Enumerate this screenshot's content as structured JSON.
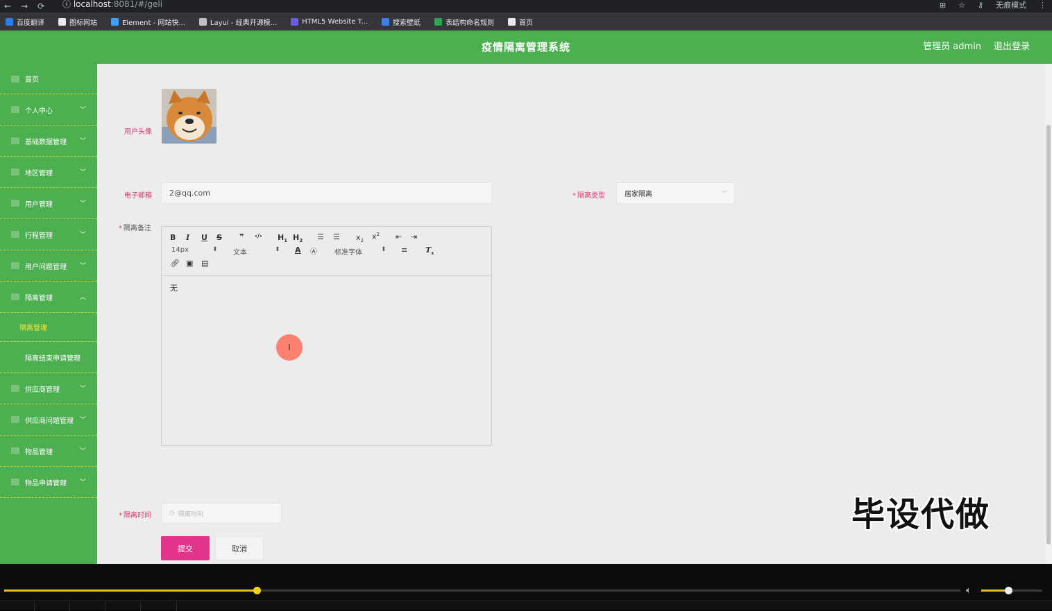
{
  "browser": {
    "url_host": "localhost",
    "url_rest": ":8081/#/geli",
    "mode_label": "无痕模式"
  },
  "bookmarks": [
    {
      "label": "百度翻译",
      "color": "#2b7de9"
    },
    {
      "label": "图标网站",
      "color": "#e8eaed"
    },
    {
      "label": "Element - 网站快...",
      "color": "#409eff"
    },
    {
      "label": "Layui - 经典开源模...",
      "color": "#c0c0c0"
    },
    {
      "label": "HTML5 Website T...",
      "color": "#6c5ce7"
    },
    {
      "label": "搜索壁纸",
      "color": "#3f7ee8"
    },
    {
      "label": "表结构命名规则",
      "color": "#2ea44f"
    },
    {
      "label": "首页",
      "color": "#e8eaed"
    }
  ],
  "header": {
    "title": "疫情隔离管理系统",
    "user": "管理员 admin",
    "logout": "退出登录"
  },
  "sidebar": {
    "items": [
      {
        "label": "首页"
      },
      {
        "label": "个人中心"
      },
      {
        "label": "基础数据管理"
      },
      {
        "label": "地区管理"
      },
      {
        "label": "用户管理"
      },
      {
        "label": "行程管理"
      },
      {
        "label": "用户问题管理"
      },
      {
        "label": "隔离管理"
      }
    ],
    "sub_items": [
      "隔离管理",
      "隔离结束申请管理"
    ],
    "items_after": [
      {
        "label": "供应商管理"
      },
      {
        "label": "供应商问题管理"
      },
      {
        "label": "物品管理"
      },
      {
        "label": "物品申请管理"
      }
    ]
  },
  "form": {
    "avatar_label": "用户头像",
    "email_label": "电子邮箱",
    "email_value": "2@qq.com",
    "type_label": "隔离类型",
    "type_value": "居家隔离",
    "remark_label": "隔离备注",
    "remark_value": "无",
    "time_label": "隔离时间",
    "time_placeholder": "隔离时间",
    "submit": "提交",
    "cancel": "取消"
  },
  "editor_toolbar": {
    "size": "14px",
    "header": "文本",
    "font": "标准字体"
  },
  "watermark": "毕设代做",
  "video": {
    "progress_fraction": 0.264,
    "volume_fraction": 0.44
  }
}
